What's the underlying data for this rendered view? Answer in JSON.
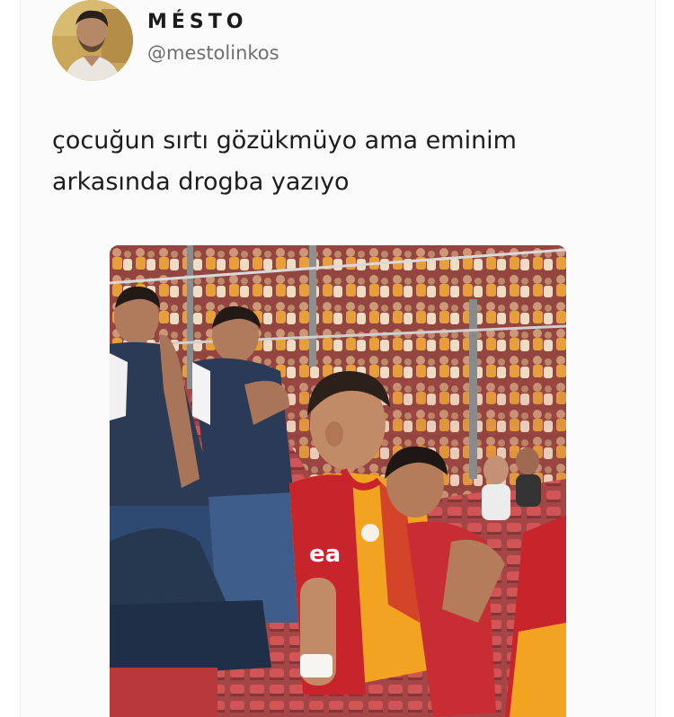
{
  "user": {
    "display_name": "MÉSTO",
    "handle": "@mestolinkos",
    "avatar_icon": "avatar-photo"
  },
  "tweet": {
    "line1": "çocuğun sırtı gözükmüyo ama eminim",
    "line2": "arkasında drogba yazıyo"
  },
  "media": {
    "jersey_text": "ea"
  },
  "colors": {
    "text": "#1d1d1f",
    "muted": "#6e6e73",
    "jersey_red": "#c8242b",
    "jersey_yellow": "#f2a321"
  }
}
